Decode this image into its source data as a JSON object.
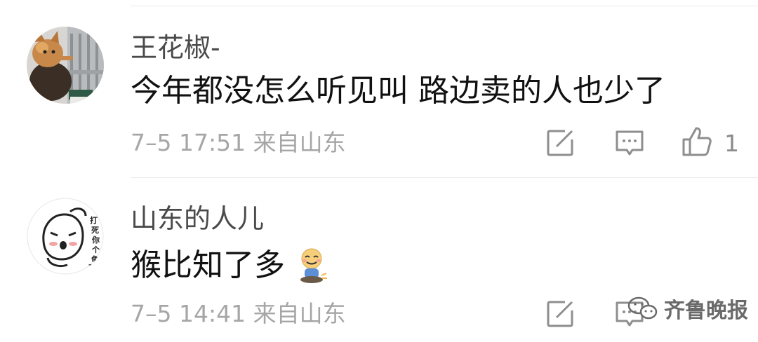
{
  "comments": [
    {
      "username": "王花椒-",
      "text": "今年都没怎么听见叫 路边卖的人也少了",
      "meta": "7–5 17:51 来自山东",
      "likes": "1",
      "avatar_icon": "cat-photo-avatar"
    },
    {
      "username": "山东的人儿",
      "text": "猴比知了多",
      "meta": "7–5 14:41 来自山东",
      "likes": "",
      "avatar_icon": "cartoon-face-avatar",
      "emoji_icon": "smiling-figure-emoji",
      "avatar_sticker_text": "打死你个龟孙"
    }
  ],
  "actions": {
    "repost_icon": "edit-square-icon",
    "reply_icon": "comment-bubble-icon",
    "like_icon": "thumbs-up-icon"
  },
  "watermark": {
    "text": "齐鲁晚报",
    "icon": "wechat-logo-icon"
  }
}
